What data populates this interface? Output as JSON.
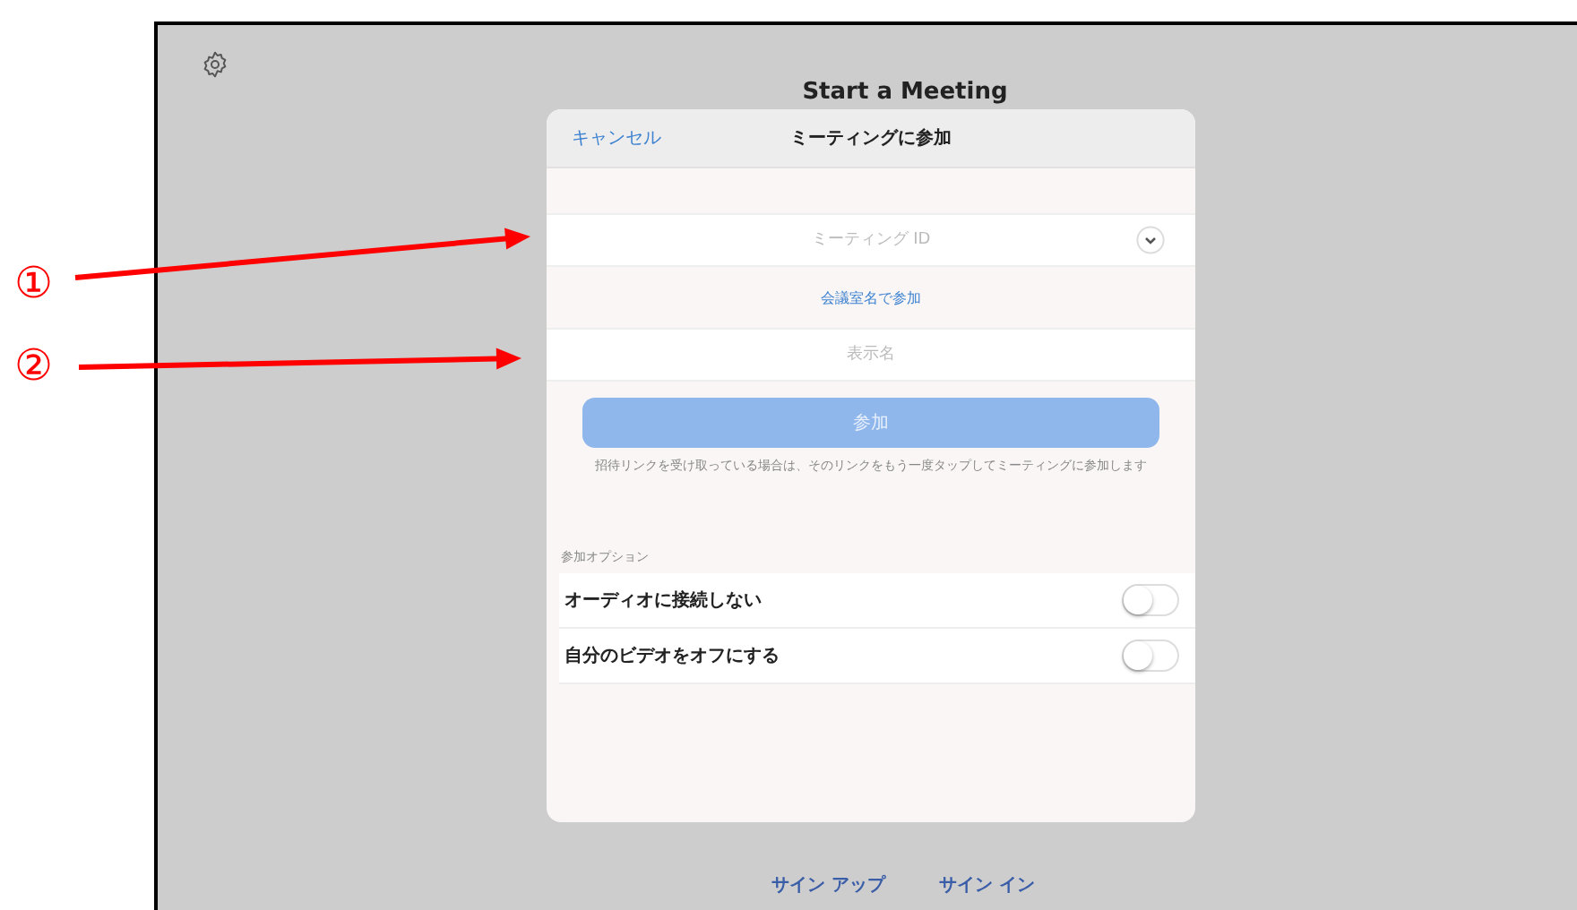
{
  "screen_title": "Start a Meeting",
  "dialog": {
    "cancel": "キャンセル",
    "title": "ミーティングに参加",
    "meeting_id_field": {
      "placeholder": "ミーティング ID"
    },
    "room_name_link": "会議室名で参加",
    "name_field": {
      "placeholder": "表示名"
    },
    "join_button": {
      "label": "参加",
      "disabled": true
    },
    "help_text": "招待リンクを受け取っている場合は、そのリンクをもう一度タップしてミーティングに参加します",
    "options_heading": "参加オプション",
    "options": [
      {
        "label": "オーディオに接続しない",
        "on": false
      },
      {
        "label": "自分のビデオをオフにする",
        "on": false
      }
    ]
  },
  "footer_links": [
    "サイン アップ",
    "サイン イン"
  ],
  "annotations": [
    {
      "label": "①"
    },
    {
      "label": "②"
    }
  ]
}
